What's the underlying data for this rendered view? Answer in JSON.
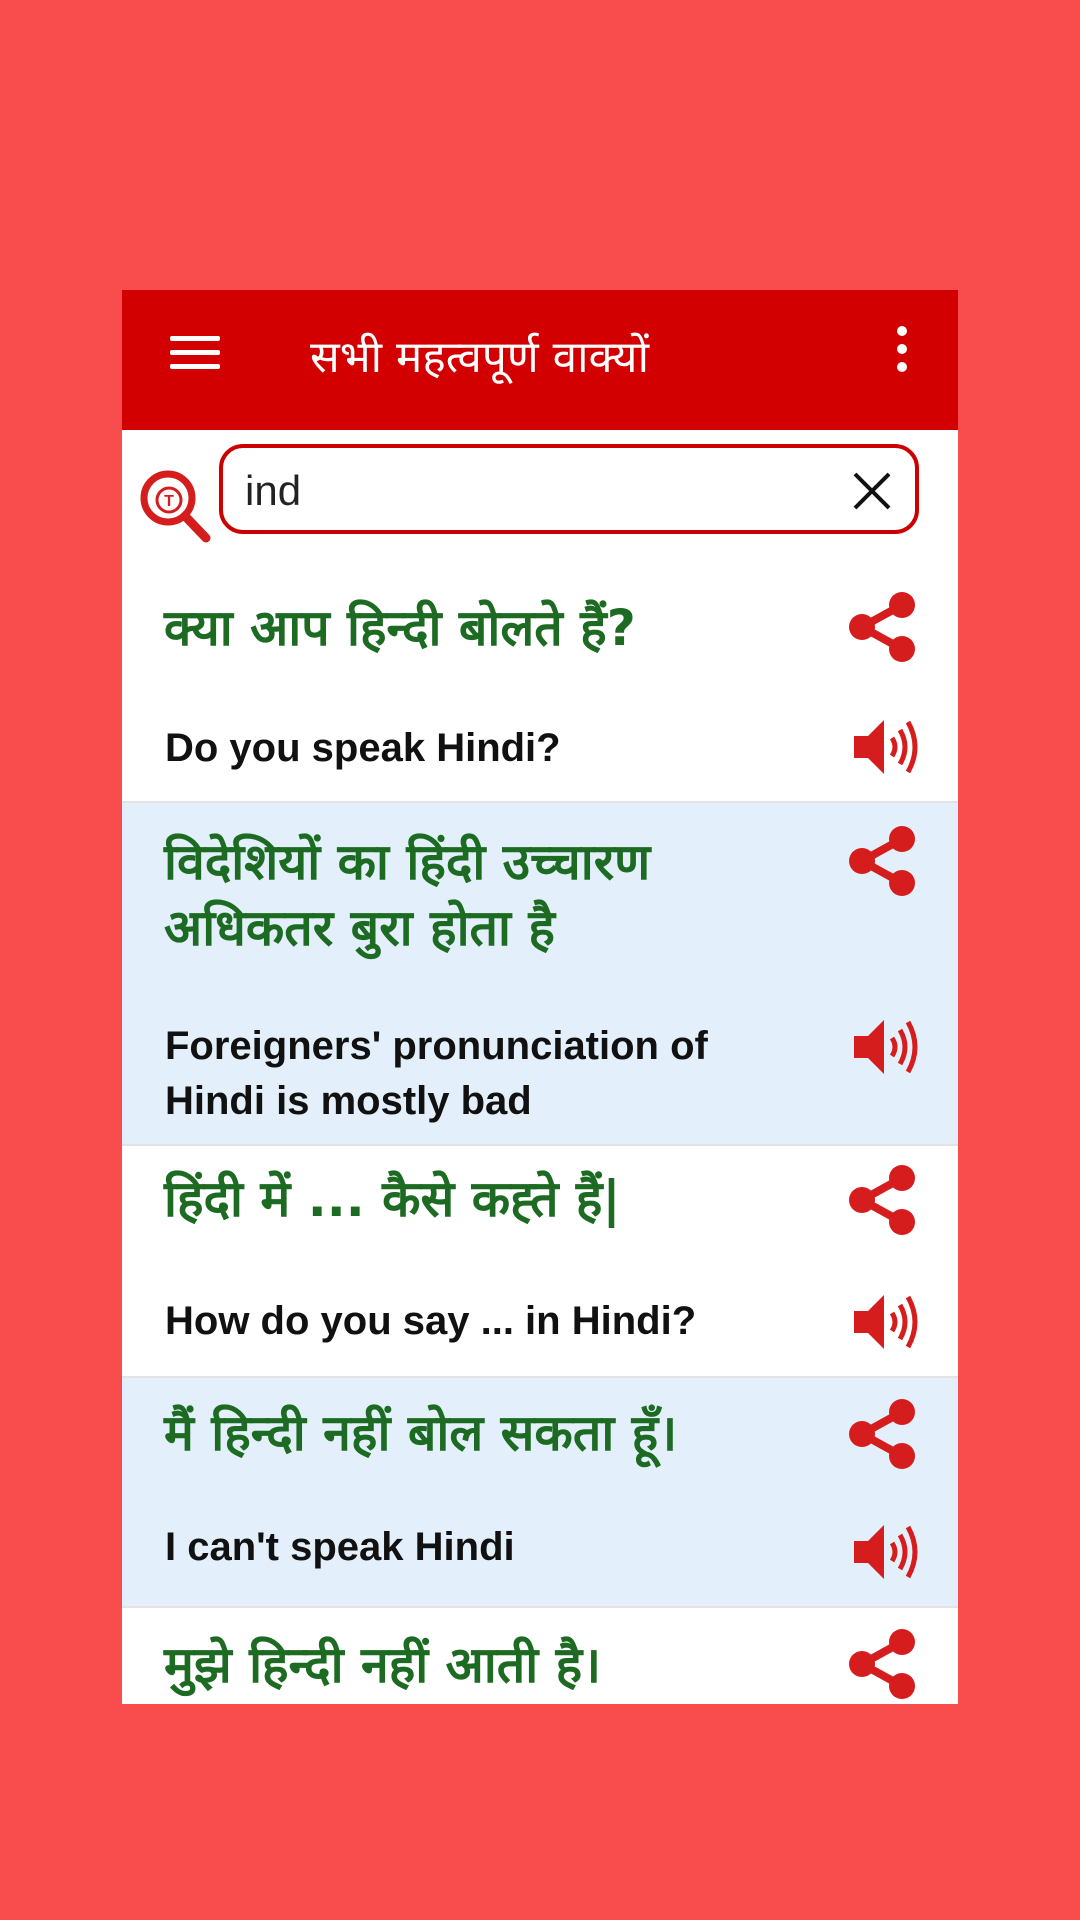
{
  "colors": {
    "background": "#f94d4d",
    "header": "#d20000",
    "accent": "#d61d1d",
    "hindi_text": "#1d6b23",
    "alt_row": "#e3f0fb"
  },
  "header": {
    "title": "सभी महत्वपूर्ण वाक्यों",
    "menu_icon": "hamburger-icon",
    "more_icon": "more-vertical-icon"
  },
  "search": {
    "value": "ind",
    "placeholder": "",
    "icon": "translate-search-icon",
    "clear_icon": "close-icon"
  },
  "phrases": [
    {
      "hindi": "क्या आप हिन्दी बोलते हैं?",
      "english": "Do you speak Hindi?"
    },
    {
      "hindi": " विदेशियों का हिंदी उच्चारण अधिकतर बुरा होता है",
      "english": "Foreigners' pronunciation of Hindi is mostly bad"
    },
    {
      "hindi": "हिंदी में ... कैसे कह्ते हैं|",
      "english": "How do you say ... in Hindi?"
    },
    {
      "hindi": "मैं हिन्दी नहीं बोल सकता हूँ।",
      "english": "I can't speak Hindi"
    },
    {
      "hindi": "मुझे हिन्दी नहीं आती है।",
      "english": ""
    }
  ]
}
